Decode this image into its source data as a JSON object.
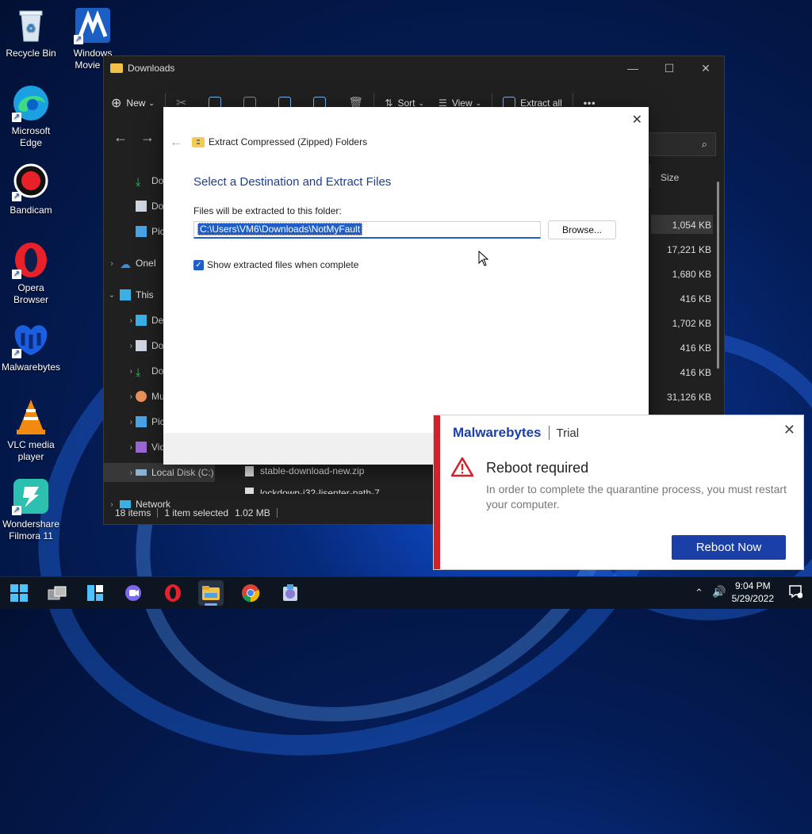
{
  "desktop": {
    "icons": [
      {
        "label": "Recycle Bin",
        "icon": "recycle-bin-icon"
      },
      {
        "label": "Windows Movie M",
        "icon": "movie-maker-icon"
      },
      {
        "label": "Microsoft Edge",
        "icon": "edge-icon"
      },
      {
        "label": "Bandicam",
        "icon": "bandicam-icon"
      },
      {
        "label": "Opera Browser",
        "icon": "opera-icon"
      },
      {
        "label": "Malwarebytes",
        "icon": "malwarebytes-icon"
      },
      {
        "label": "VLC media player",
        "icon": "vlc-icon"
      },
      {
        "label": "Wondershare Filmora 11",
        "icon": "filmora-icon"
      }
    ]
  },
  "explorer": {
    "title": "Downloads",
    "toolbar": {
      "new_label": "New",
      "sort_label": "Sort",
      "view_label": "View",
      "extract_label": "Extract all",
      "more_label": "•••"
    },
    "nav": [
      {
        "label": "Dow",
        "indent": 2
      },
      {
        "label": "Doc",
        "indent": 2
      },
      {
        "label": "Pic",
        "indent": 2
      },
      {
        "label": "OneI",
        "indent": 1
      },
      {
        "label": "This",
        "indent": 0
      },
      {
        "label": "Des",
        "indent": 1
      },
      {
        "label": "Doc",
        "indent": 1
      },
      {
        "label": "Dow",
        "indent": 1
      },
      {
        "label": "Mu",
        "indent": 1
      },
      {
        "label": "Pic",
        "indent": 1
      },
      {
        "label": "Vid",
        "indent": 1
      },
      {
        "label": "Local Disk (C:)",
        "indent": 1
      },
      {
        "label": "Network",
        "indent": 0
      }
    ],
    "size_header": "Size",
    "sizes": [
      "1,054 KB",
      "17,221 KB",
      "1,680 KB",
      "416 KB",
      "1,702 KB",
      "416 KB",
      "416 KB",
      "31,126 KB"
    ],
    "visible_files": [
      "stable-download-new.zip",
      "lockdown-i32-lisenter-path-7"
    ],
    "status": {
      "items": "18 items",
      "selected": "1 item selected",
      "size": "1.02 MB"
    }
  },
  "dialog": {
    "title": "Extract Compressed (Zipped) Folders",
    "heading": "Select a Destination and Extract Files",
    "label": "Files will be extracted to this folder:",
    "path": "C:\\Users\\VM6\\Downloads\\NotMyFault",
    "browse": "Browse...",
    "checkbox_label": "Show extracted files when complete",
    "checkbox_checked": true
  },
  "toast": {
    "brand": "Malwarebytes",
    "tier": "Trial",
    "title": "Reboot required",
    "message": "In order to complete the quarantine process, you must restart your computer.",
    "button": "Reboot Now",
    "accent": "#d61f26"
  },
  "taskbar": {
    "time": "9:04 PM",
    "date": "5/29/2022",
    "apps": [
      "start-icon",
      "task-view-icon",
      "widgets-icon",
      "chat-icon",
      "opera-icon",
      "file-explorer-icon",
      "chrome-icon",
      "installer-icon"
    ]
  }
}
